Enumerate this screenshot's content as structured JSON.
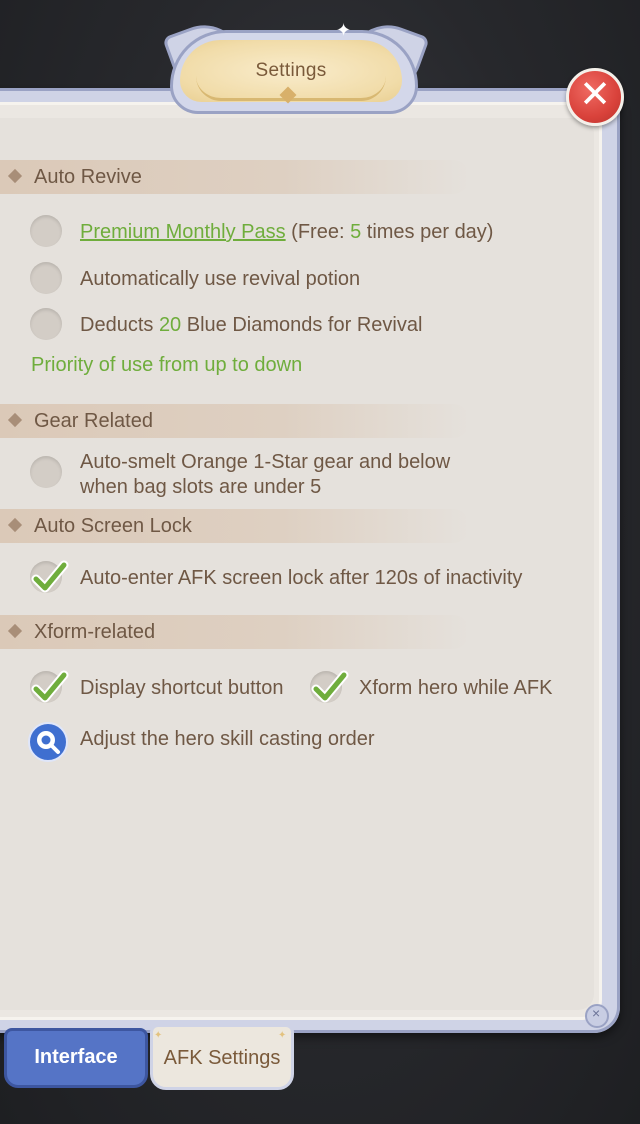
{
  "window": {
    "title": "Settings"
  },
  "sections": {
    "auto_revive": {
      "header": "Auto Revive",
      "options": [
        {
          "link": "Premium Monthly Pass",
          "rest_a": " (Free: ",
          "count": "5",
          "rest_b": " times per day)"
        },
        {
          "text": "Automatically use revival potion"
        },
        {
          "text_a": "Deducts ",
          "count": "20",
          "text_b": " Blue Diamonds for Revival"
        }
      ],
      "priority_note": "Priority of use from up to down"
    },
    "gear_related": {
      "header": "Gear Related",
      "option_line1": "Auto-smelt Orange 1-Star gear and below",
      "option_line2": "when bag slots are under 5"
    },
    "auto_screen_lock": {
      "header": "Auto Screen Lock",
      "option": "Auto-enter AFK screen lock after 120s of inactivity",
      "checked": true
    },
    "xform_related": {
      "header": "Xform-related",
      "display_shortcut": "Display shortcut button",
      "xform_hero": "Xform hero while AFK",
      "adjust_order": "Adjust the hero skill casting order"
    }
  },
  "tabs": [
    {
      "label": "Interface",
      "active": false
    },
    {
      "label": "AFK Settings",
      "active": true
    }
  ],
  "colors": {
    "accent_green": "#6fad3c",
    "text_brown": "#6f5845",
    "tab_blue": "#5574c6",
    "close_red": "#d9423b"
  },
  "icons": [
    "close-icon",
    "checkmark-icon",
    "search-icon",
    "diamond-bullet-icon",
    "sparkle-icon"
  ]
}
